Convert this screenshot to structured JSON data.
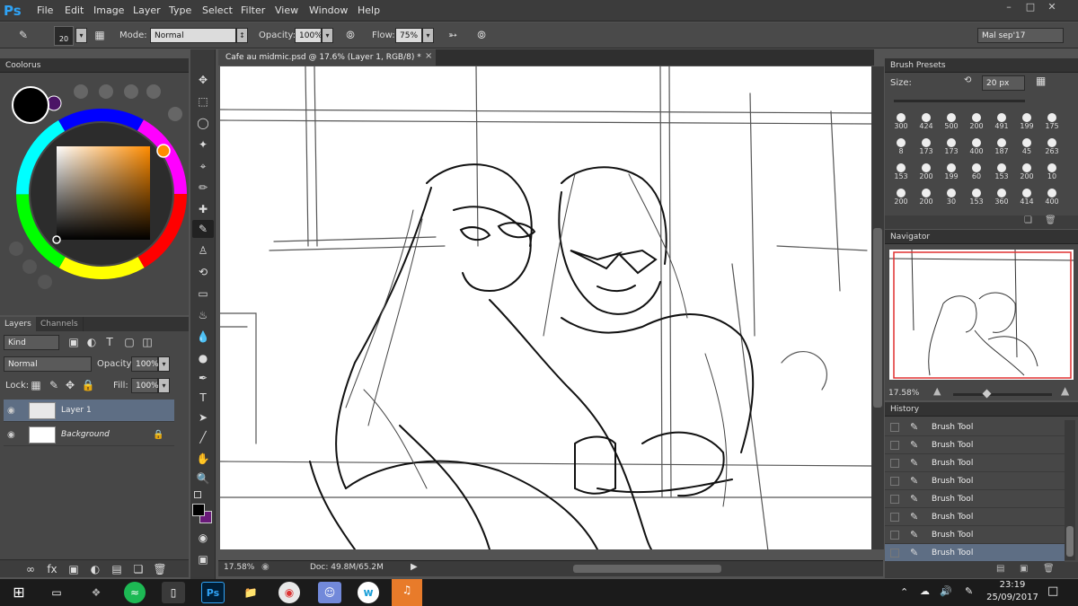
{
  "app": {
    "logo": "Ps"
  },
  "menu": [
    "File",
    "Edit",
    "Image",
    "Layer",
    "Type",
    "Select",
    "Filter",
    "View",
    "Window",
    "Help"
  ],
  "options": {
    "brush_size": "20",
    "mode_label": "Mode:",
    "mode_value": "Normal",
    "opacity_label": "Opacity:",
    "opacity_value": "100%",
    "flow_label": "Flow:",
    "flow_value": "75%",
    "workspace": "Mal sep'17"
  },
  "colorus": {
    "title": "Coolorus"
  },
  "layers_panel": {
    "tabs": [
      "Layers",
      "Channels"
    ],
    "kind_label": "Kind",
    "blend_mode": "Normal",
    "opacity_label": "Opacity:",
    "opacity_value": "100%",
    "lock_label": "Lock:",
    "fill_label": "Fill:",
    "fill_value": "100%",
    "layers": [
      {
        "name": "Layer 1",
        "selected": true
      },
      {
        "name": "Background",
        "selected": false
      }
    ]
  },
  "document": {
    "tab_title": "Cafe au midmic.psd @ 17.6% (Layer 1, RGB/8) *",
    "zoom": "17.58%",
    "doc_size": "Doc: 49.8M/65.2M"
  },
  "brush_presets": {
    "title": "Brush Presets",
    "size_label": "Size:",
    "size_value": "20 px",
    "sizes": [
      "300",
      "424",
      "500",
      "200",
      "491",
      "199",
      "175",
      "8",
      "173",
      "173",
      "400",
      "187",
      "45",
      "263",
      "153",
      "200",
      "199",
      "60",
      "153",
      "200",
      "10",
      "200",
      "200",
      "30",
      "153",
      "360",
      "414",
      "400"
    ]
  },
  "navigator": {
    "title": "Navigator",
    "zoom": "17.58%"
  },
  "history": {
    "title": "History",
    "items": [
      "Brush Tool",
      "Brush Tool",
      "Brush Tool",
      "Brush Tool",
      "Brush Tool",
      "Brush Tool",
      "Brush Tool",
      "Brush Tool"
    ]
  },
  "taskbar": {
    "time": "23:19",
    "date": "25/09/2017",
    "ps_label": "Ps"
  },
  "colors": {
    "accent": "#2fa3f6",
    "selection": "#5e6e84",
    "foreground": "#000000",
    "background": "#6a1a7a"
  }
}
